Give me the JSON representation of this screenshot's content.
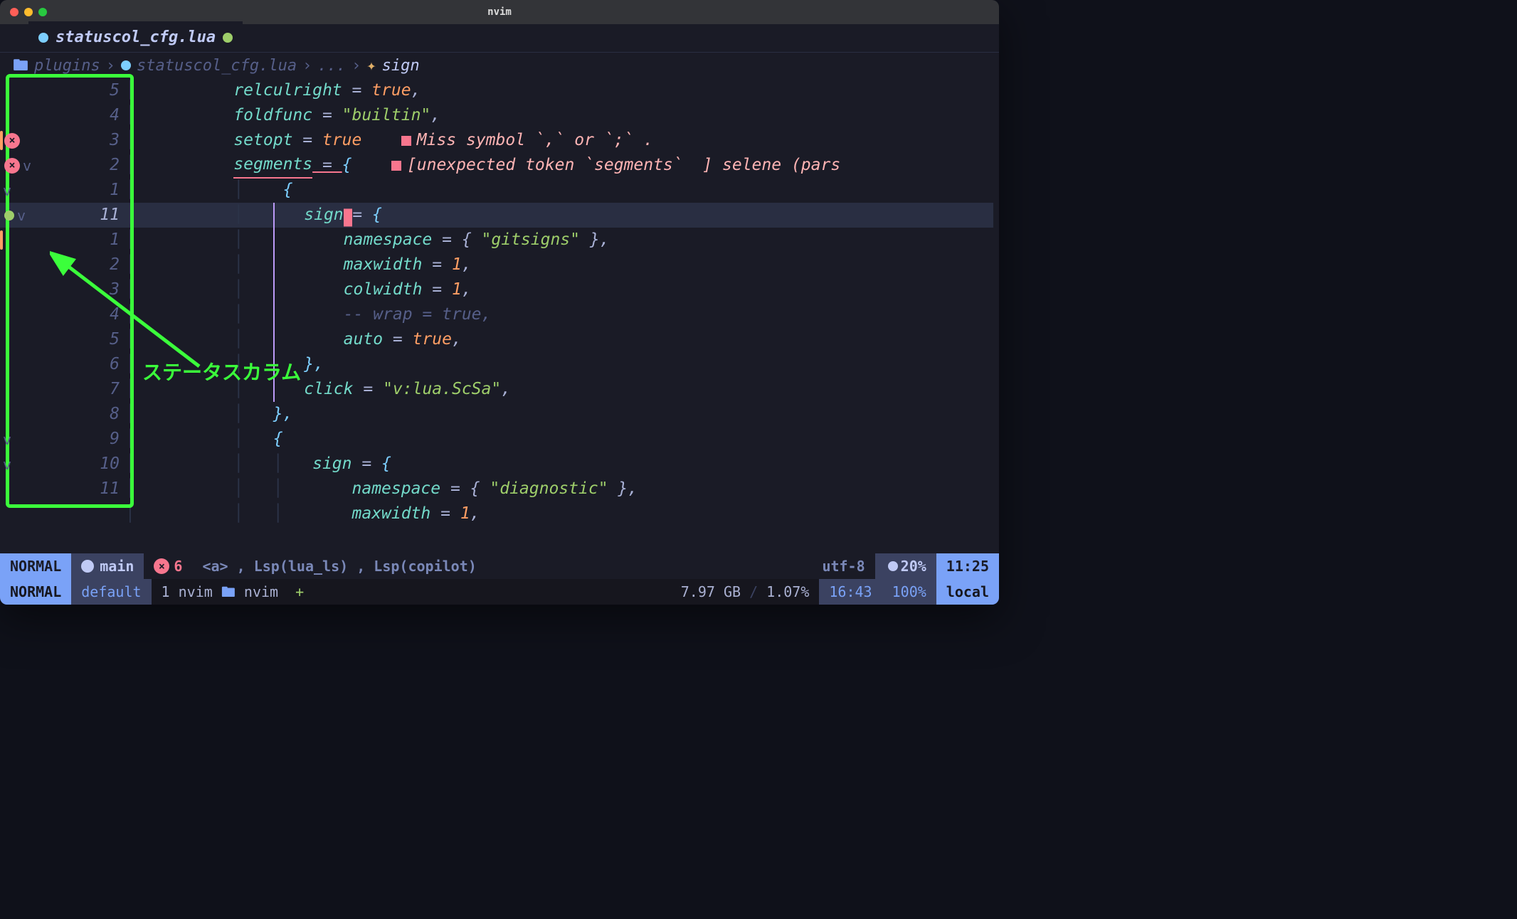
{
  "window": {
    "title": "nvim"
  },
  "tab": {
    "filename": "statuscol_cfg.lua",
    "modified": true
  },
  "breadcrumbs": {
    "parts": [
      "plugins",
      "statuscol_cfg.lua",
      "...",
      "sign"
    ]
  },
  "annotation": {
    "label": "ステータスカラム"
  },
  "gutter": [
    {
      "num": "5"
    },
    {
      "num": "4"
    },
    {
      "num": "3",
      "bar": true,
      "diag": "×",
      "warn": true
    },
    {
      "num": "2",
      "diag": "×",
      "fold": "v",
      "warn": true
    },
    {
      "num": "1",
      "fold": "v"
    },
    {
      "num": "11",
      "dot": true,
      "fold": "v",
      "current": true
    },
    {
      "num": "1",
      "bar": true
    },
    {
      "num": "2"
    },
    {
      "num": "3"
    },
    {
      "num": "4"
    },
    {
      "num": "5"
    },
    {
      "num": "6"
    },
    {
      "num": "7"
    },
    {
      "num": "8"
    },
    {
      "num": "9",
      "fold": "v"
    },
    {
      "num": "10",
      "fold": "v"
    },
    {
      "num": "11"
    },
    {
      "num": ""
    }
  ],
  "code": {
    "l1_field": "relculright",
    "l1_val": "true",
    "l2_field": "foldfunc",
    "l2_val": "\"builtin\"",
    "l3_field": "setopt",
    "l3_val": "true",
    "l3_diag": "Miss symbol `,` or `;` .",
    "l4_field": "segments",
    "l4_diag": "[unexpected token `segments`  ] selene (pars",
    "l6_field": "sign",
    "l7_field": "namespace",
    "l7_val": "\"gitsigns\"",
    "l8_field": "maxwidth",
    "l8_val": "1",
    "l9_field": "colwidth",
    "l9_val": "1",
    "l10_comment": "-- wrap = true,",
    "l11_field": "auto",
    "l11_val": "true",
    "l13_field": "click",
    "l13_val": "\"v:lua.ScSa\"",
    "l16_field": "sign",
    "l17_field": "namespace",
    "l17_val": "\"diagnostic\"",
    "l18_field": "maxwidth",
    "l18_val": "1"
  },
  "statusline": {
    "mode": "NORMAL",
    "branch": "main",
    "diag_count": "6",
    "center": "<a>  ,  Lsp(lua_ls) , Lsp(copilot)",
    "encoding": "utf-8",
    "percent": "20%",
    "pos": "11:25"
  },
  "tmux": {
    "mode": "NORMAL",
    "session": "default",
    "window_index": "1",
    "window_name": "nvim",
    "path": "nvim",
    "plus": "+",
    "mem": "7.97 GB",
    "cpu": "1.07%",
    "time": "16:43",
    "batt": "100%",
    "host": "local"
  }
}
